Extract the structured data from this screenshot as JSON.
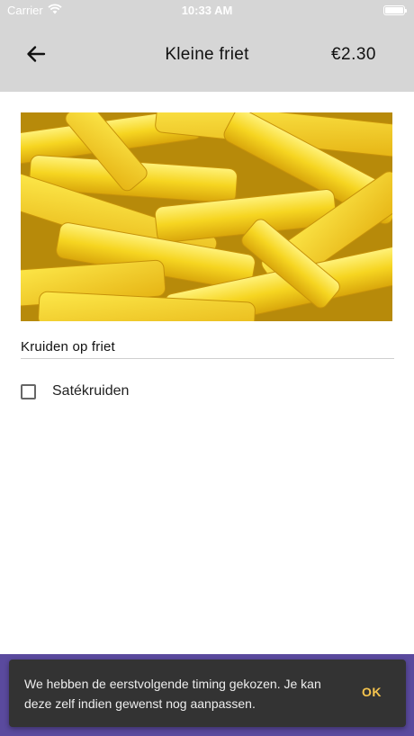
{
  "status_bar": {
    "carrier": "Carrier",
    "time": "10:33 AM",
    "battery_level": 1.0
  },
  "app_bar": {
    "back_icon": "arrow-left-icon",
    "title": "Kleine friet",
    "price": "€2.30"
  },
  "product": {
    "image": "fries-photo"
  },
  "options_section": {
    "title": "Kruiden op friet",
    "options": [
      {
        "label": "Satékruiden",
        "checked": false
      }
    ]
  },
  "snackbar": {
    "message": "We hebben de eerstvolgende timing gekozen. Je kan deze zelf indien gewenst nog aanpassen.",
    "action": "OK"
  },
  "colors": {
    "app_bar": "#d6d6d6",
    "bottom_bar": "#5a4a9e",
    "snackbar_bg": "#333333",
    "snackbar_action": "#f5c44e",
    "fries": "#f2d11a"
  }
}
